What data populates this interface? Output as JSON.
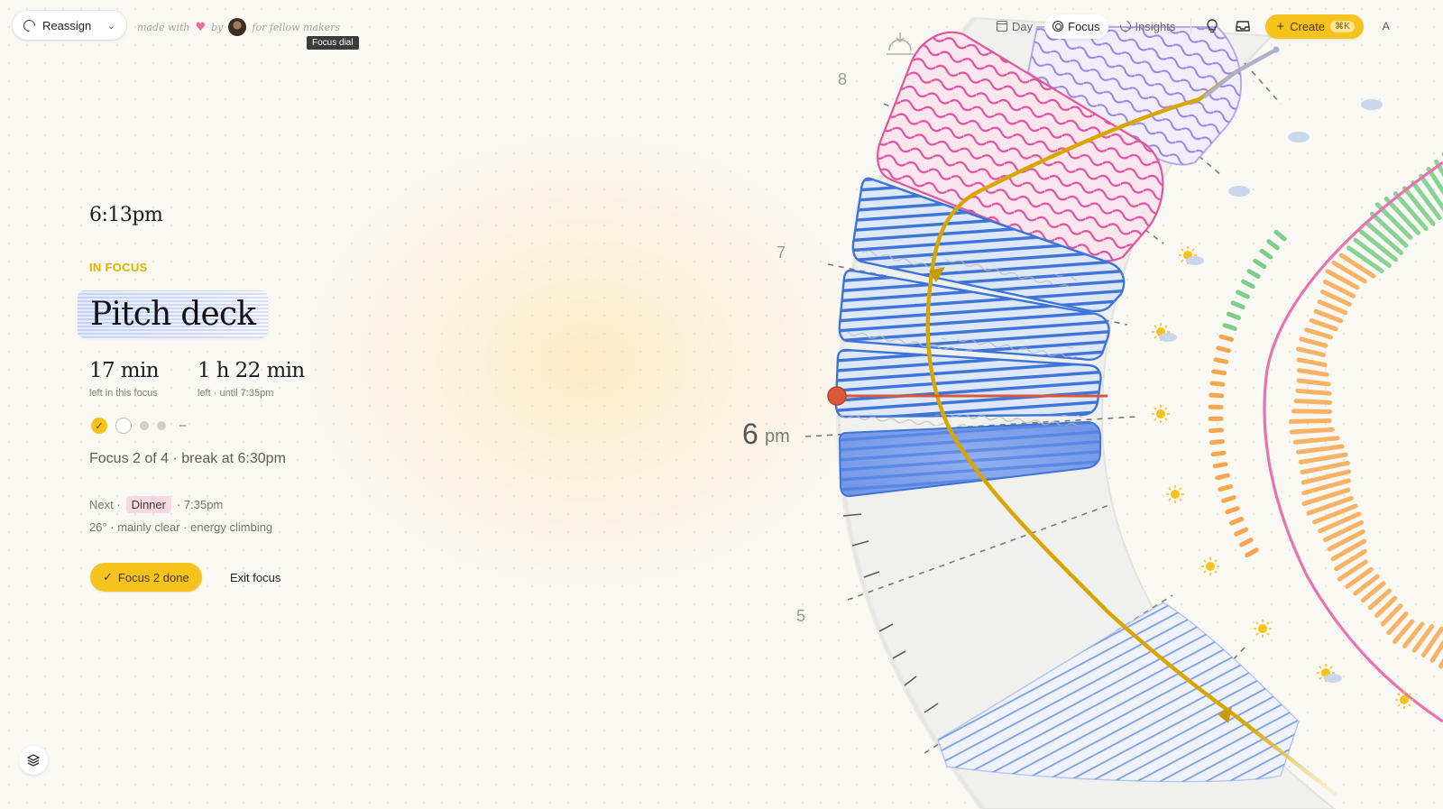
{
  "header": {
    "reassign_label": "Reassign",
    "made_with": "made with",
    "by": "by",
    "tagline": "for fellow makers",
    "tooltip": "Focus dial"
  },
  "nav": {
    "tabs": [
      {
        "label": "Day",
        "icon": "calendar-icon"
      },
      {
        "label": "Focus",
        "icon": "target-icon",
        "active": true
      },
      {
        "label": "Insights",
        "icon": "insights-icon"
      }
    ],
    "icons": [
      "lightbulb-icon",
      "inbox-icon"
    ],
    "create_label": "Create",
    "create_shortcut": "⌘K",
    "avatar_initial": "A"
  },
  "focus": {
    "current_time": "6:13pm",
    "state_label": "IN FOCUS",
    "task_title": "Pitch deck",
    "left_in_focus": {
      "value": "17 min",
      "caption": "left in this focus"
    },
    "left_total": {
      "value": "1 h 22 min",
      "caption": "left · until 7:35pm"
    },
    "progress": {
      "done": 1,
      "current": 2,
      "total": 4
    },
    "summary": "Focus 2 of 4 · break at 6:30pm",
    "next_prefix": "Next ·",
    "next_event": "Dinner",
    "next_time": "· 7:35pm",
    "conditions": "26° · mainly clear · energy climbing",
    "done_button": "Focus 2 done",
    "exit_button": "Exit focus"
  },
  "dial": {
    "hour_labels": [
      "8",
      "7",
      "6",
      "pm",
      "5"
    ],
    "colors": {
      "accent": "#f6c21c",
      "focus_block": "#3d74d8",
      "pink_block": "#e0529a",
      "purple_block": "#9a86e0",
      "now_line": "#d9583a",
      "energy_line": "#d9a600",
      "warm_bars": "#f7a64e",
      "cool_bars": "#7ccf8a",
      "pink_curve": "#e872b0"
    }
  }
}
